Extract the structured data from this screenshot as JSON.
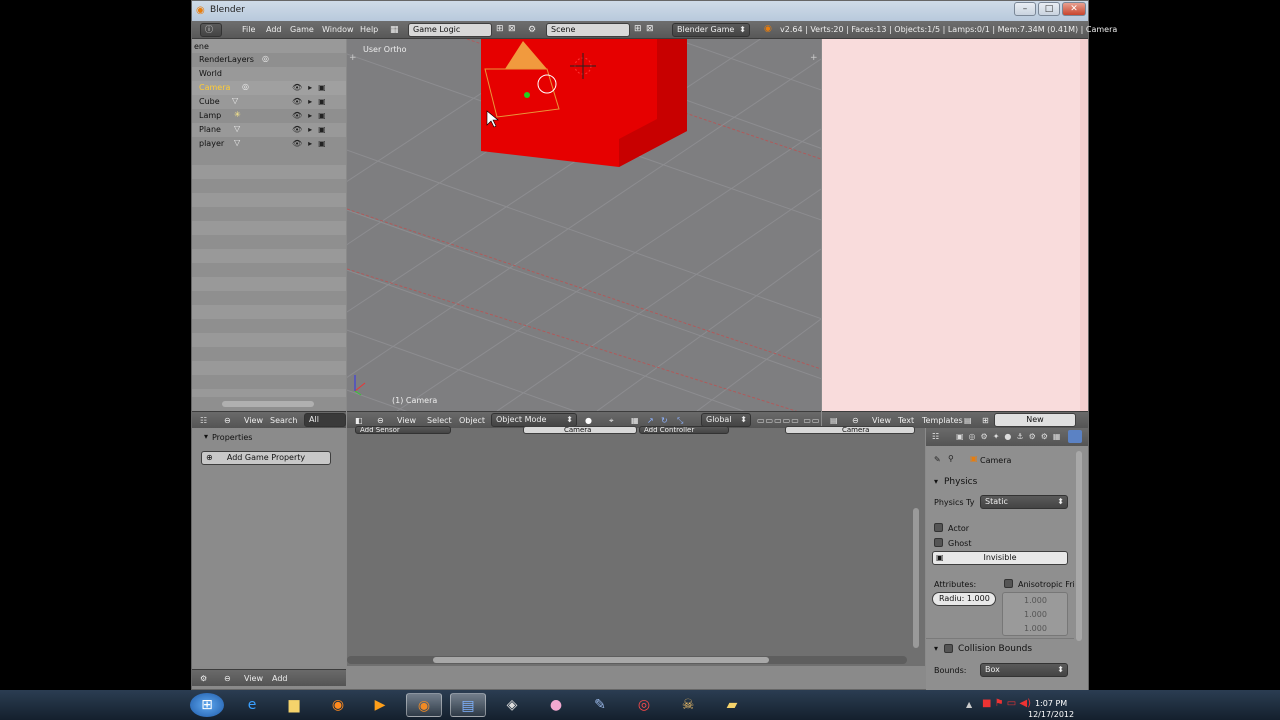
{
  "window": {
    "title": "Blender"
  },
  "topbar": {
    "menus": [
      "File",
      "Add",
      "Game",
      "Window",
      "Help"
    ],
    "screen_layout": "Game Logic",
    "scene": "Scene",
    "engine": "Blender Game",
    "stats": "v2.64 | Verts:20 | Faces:13 | Objects:1/5 | Lamps:0/1 | Mem:7.34M (0.41M) | Camera"
  },
  "outliner": {
    "partial_label": "ene",
    "items": [
      {
        "name": "RenderLayers",
        "selected": false
      },
      {
        "name": "World",
        "selected": false
      },
      {
        "name": "Camera",
        "selected": true
      },
      {
        "name": "Cube",
        "selected": false
      },
      {
        "name": "Lamp",
        "selected": false
      },
      {
        "name": "Plane",
        "selected": false
      },
      {
        "name": "player",
        "selected": false
      }
    ],
    "header": {
      "view": "View",
      "search": "Search",
      "scenes": "All Scenes"
    }
  },
  "viewport": {
    "label": "User Ortho",
    "object_label": "(1) Camera",
    "header": {
      "view": "View",
      "select": "Select",
      "object": "Object",
      "mode": "Object Mode",
      "orientation": "Global"
    },
    "cube_color": "#e60000"
  },
  "text_editor": {
    "header": {
      "view": "View",
      "text": "Text",
      "templates": "Templates",
      "new": "New"
    },
    "bg_color": "#f9dcdc"
  },
  "props_left": {
    "panel_title": "Properties",
    "add_button": "Add Game Property",
    "footer": {
      "view": "View",
      "add": "Add"
    }
  },
  "logic": {
    "sensor_button": "Add Sensor",
    "camera_a": "Camera",
    "controller_button": "Add Controller",
    "camera_b": "Camera"
  },
  "props_right": {
    "object": "Camera",
    "physics_title": "Physics",
    "physics_type_label": "Physics Ty",
    "physics_type_value": "Static",
    "actor": "Actor",
    "ghost": "Ghost",
    "invisible": "Invisible",
    "attributes": "Attributes:",
    "anisotropic": "Anisotropic Fri",
    "radius": "Radiu: 1.000",
    "values": [
      "1.000",
      "1.000",
      "1.000"
    ],
    "collision_title": "Collision Bounds",
    "bounds_label": "Bounds:",
    "bounds_value": "Box"
  },
  "taskbar": {
    "time": "1:07 PM",
    "date": "12/17/2012"
  }
}
